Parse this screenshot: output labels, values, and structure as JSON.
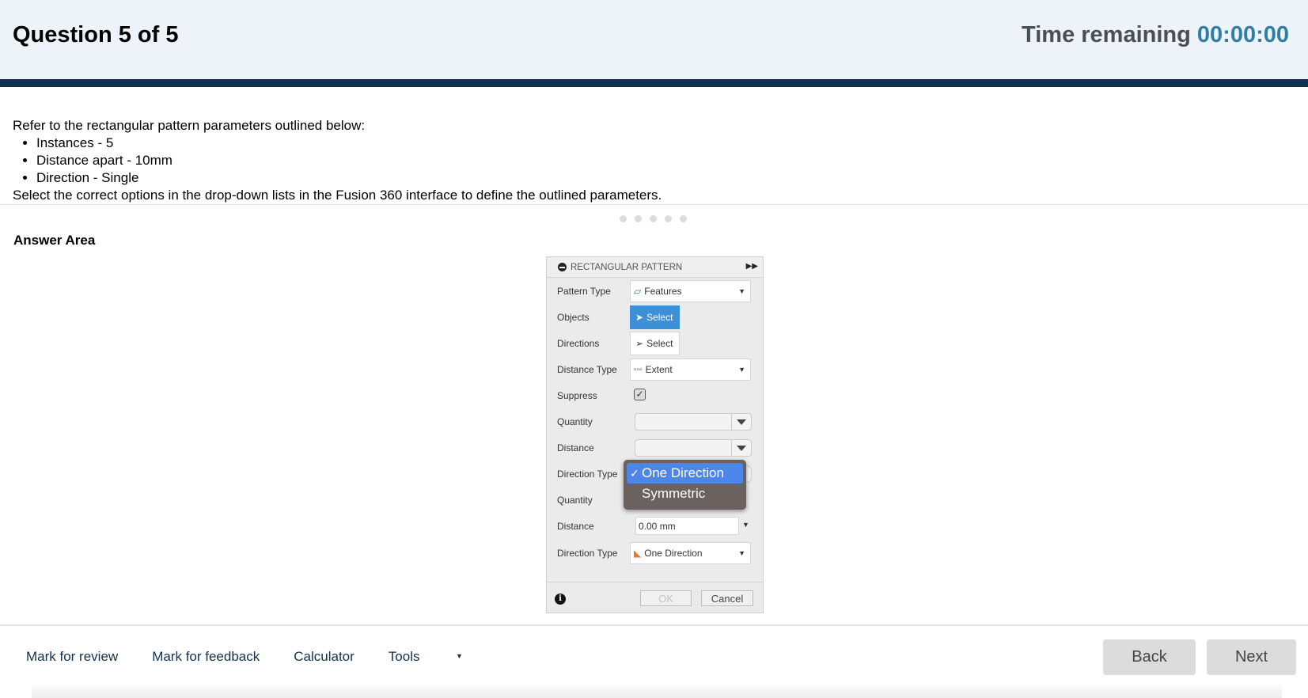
{
  "header": {
    "question": "Question 5 of 5",
    "time_label": "Time remaining",
    "time_value": "00:00:00"
  },
  "prompt": {
    "intro": "Refer to the rectangular pattern parameters outlined below:",
    "bullets": [
      "Instances - 5",
      "Distance apart - 10mm",
      "Direction - Single"
    ],
    "instruction": "Select the correct options in the drop-down lists in the Fusion 360 interface to define the outlined parameters."
  },
  "answer_area": "Answer Area",
  "dialog": {
    "title": "RECTANGULAR PATTERN",
    "pattern_type_label": "Pattern Type",
    "pattern_type_value": "Features",
    "objects_label": "Objects",
    "objects_button": "Select",
    "directions_label": "Directions",
    "directions_button": "Select",
    "distance_type_label": "Distance Type",
    "distance_type_value": "Extent",
    "suppress_label": "Suppress",
    "suppress_checked": true,
    "quantity_label": "Quantity",
    "distance_label": "Distance",
    "direction_type_label": "Direction Type",
    "quantity2_label": "Quantity",
    "distance2_label": "Distance",
    "distance2_value": "0.00 mm",
    "direction_type2_label": "Direction Type",
    "direction_type2_value": "One Direction",
    "popup_options": [
      "One Direction",
      "Symmetric"
    ],
    "popup_selected": "One Direction",
    "ok": "OK",
    "cancel": "Cancel"
  },
  "footer": {
    "links": [
      "Mark for review",
      "Mark for feedback",
      "Calculator",
      "Tools"
    ],
    "back": "Back",
    "next": "Next"
  },
  "colors": {
    "header_bg": "#eef2f9",
    "bar": "#13304f",
    "timer": "#2f7ea6",
    "select_active": "#3d8fd6",
    "popup_sel": "#4d86e8"
  }
}
